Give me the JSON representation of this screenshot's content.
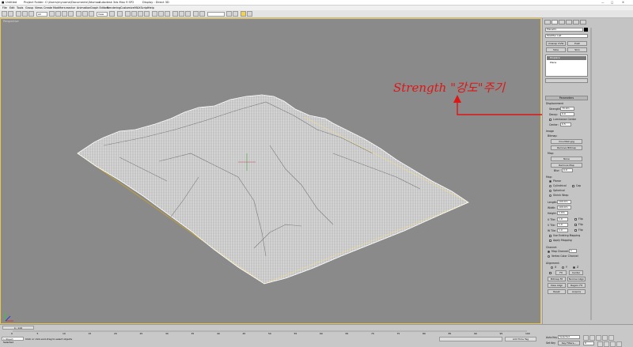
{
  "app": {
    "title_left": "Untitled",
    "project": "Project Folder: C:\\Users\\myname\\Documents\\3dsmax",
    "app_name": "Autodesk 3ds Max 9 SP2",
    "display": "Display : Direct 3D"
  },
  "menu": [
    "File",
    "Edit",
    "Tools",
    "Group",
    "Views",
    "Create",
    "Modifiers",
    "reactor",
    "Animation",
    "Graph Editors",
    "Rendering",
    "Customize",
    "MAXScript",
    "Help"
  ],
  "toolbar": {
    "selection_filter": "All",
    "view_dropdown": "View"
  },
  "viewport": {
    "label": "Perspective"
  },
  "panel": {
    "object_name": "Plane01",
    "modifier_list": "Modifier List",
    "quick_buttons": [
      "Unwrap UVW",
      "Push",
      "Slice",
      "Skin"
    ],
    "stack": [
      "Displace",
      "Plane"
    ],
    "rollout_title": "Parameters",
    "displacement_label": "Displacement",
    "strength_label": "Strength:",
    "strength_value": "70.0m",
    "decay_label": "Decay:",
    "decay_value": "0.0",
    "luminance_center": "Luminance Center",
    "center_label": "Center:",
    "center_value": "0.5",
    "image_label": "Image",
    "bitmap_label": "Bitmap:",
    "bitmap_file": "mountain.jpg",
    "remove_bitmap": "Remove Bitmap",
    "map_label": "Map:",
    "map_none": "None",
    "remove_map": "Remove Map",
    "blur_label": "Blur:",
    "blur_value": "0.0",
    "map_section": "Map:",
    "planar": "Planar",
    "cylindrical": "Cylindrical",
    "cap": "Cap",
    "spherical": "Spherical",
    "shrink_wrap": "Shrink Wrap",
    "length_label": "Length:",
    "length_value": "100.0m",
    "width_label": "Width:",
    "width_value": "100.0m",
    "height_label": "Height:",
    "height_value": "1.0m",
    "u_tile": "U Tile:",
    "u_tile_value": "1.0",
    "v_tile": "V Tile:",
    "v_tile_value": "1.0",
    "w_tile": "W Tile:",
    "w_tile_value": "1.0",
    "flip": "Flip",
    "use_existing": "Use Existing Mapping",
    "apply_mapping": "Apply Mapping",
    "channel_label": "Channel:",
    "map_channel": "Map Channel:",
    "map_channel_value": "1",
    "vertex_color": "Vertex Color Channel",
    "alignment_label": "Alignment:",
    "axis_x": "X",
    "axis_y": "Y",
    "axis_z": "Z",
    "fit": "Fit",
    "center": "Center",
    "bitmap_fit": "Bitmap Fit",
    "normal_align": "Normal Align",
    "view_align": "View Align",
    "region_fit": "Region Fit",
    "reset": "Reset",
    "acquire": "Acquire"
  },
  "annotation": {
    "text": "Strength \"강도\"주기",
    "color": "#e01515"
  },
  "timeline": {
    "frame_display": "0 / 100",
    "ticks": [
      "0",
      "5",
      "10",
      "15",
      "20",
      "25",
      "30",
      "35",
      "40",
      "45",
      "50",
      "55",
      "60",
      "65",
      "70",
      "75",
      "80",
      "85",
      "90",
      "95",
      "100"
    ]
  },
  "status": {
    "selected": "1 Object Selected",
    "prompt": "Click or click-and-drag to select objects",
    "auto_key": "Auto Key",
    "selected_dropdown": "Selected",
    "set_key": "Set Key",
    "key_filters": "Key Filters...",
    "add_time_tag": "Add Time Tag",
    "frame": "0"
  }
}
